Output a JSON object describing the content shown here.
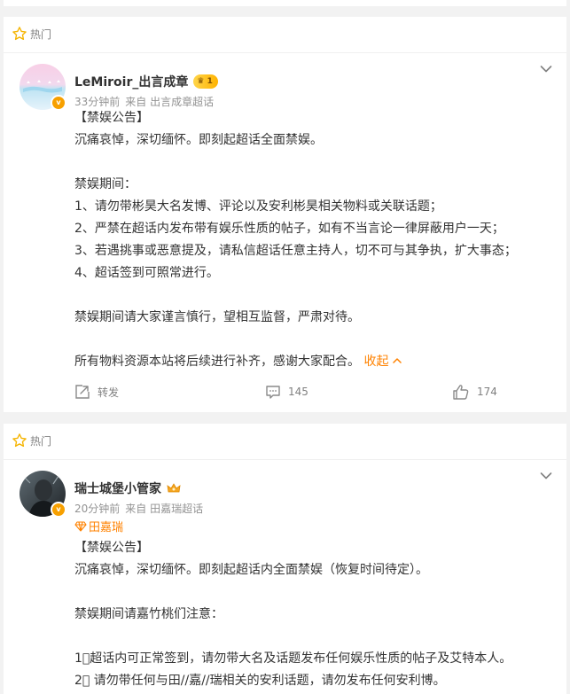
{
  "post1": {
    "hot_label": "热门",
    "username": "LeMiroir_出言成章",
    "level_badge": "1",
    "time": "33分钟前",
    "source": "来自 出言成章超话",
    "lines": [
      "【禁娱公告】",
      "沉痛哀悼，深切缅怀。即刻起超话全面禁娱。",
      "",
      "禁娱期间：",
      "1、请勿带彬昊大名发博、评论以及安利彬昊相关物料或关联话题；",
      "2、严禁在超话内发布带有娱乐性质的帖子，如有不当言论一律屏蔽用户一天；",
      "3、若遇挑事或恶意提及，请私信超话任意主持人，切不可与其争执，扩大事态；",
      "4、超话签到可照常进行。",
      "",
      "禁娱期间请大家谨言慎行，望相互监督，严肃对待。",
      ""
    ],
    "last_line": "所有物料资源本站将后续进行补齐，感谢大家配合。",
    "collapse_label": "收起",
    "repost_label": "转发",
    "comment_count": "145",
    "like_count": "174"
  },
  "post2": {
    "hot_label": "热门",
    "username": "瑞士城堡小管家",
    "time": "20分钟前",
    "source": "来自 田嘉瑞超话",
    "topic": "田嘉瑞",
    "lines": [
      "【禁娱公告】",
      "沉痛哀悼，深切缅怀。即刻起超话内全面禁娱（恢复时间待定）。",
      "",
      "禁娱期间请嘉竹桃们注意：",
      "",
      "1⃣超话内可正常签到，请勿带大名及话题发布任何娱乐性质的帖子及艾特本人。",
      "2⃣ 请勿带任何与田//嘉//瑞相关的安利话题，请勿发布任何安利博。"
    ]
  },
  "colors": {
    "accent": "#ff8200",
    "meta_text": "#939393",
    "body_text": "#333333"
  }
}
